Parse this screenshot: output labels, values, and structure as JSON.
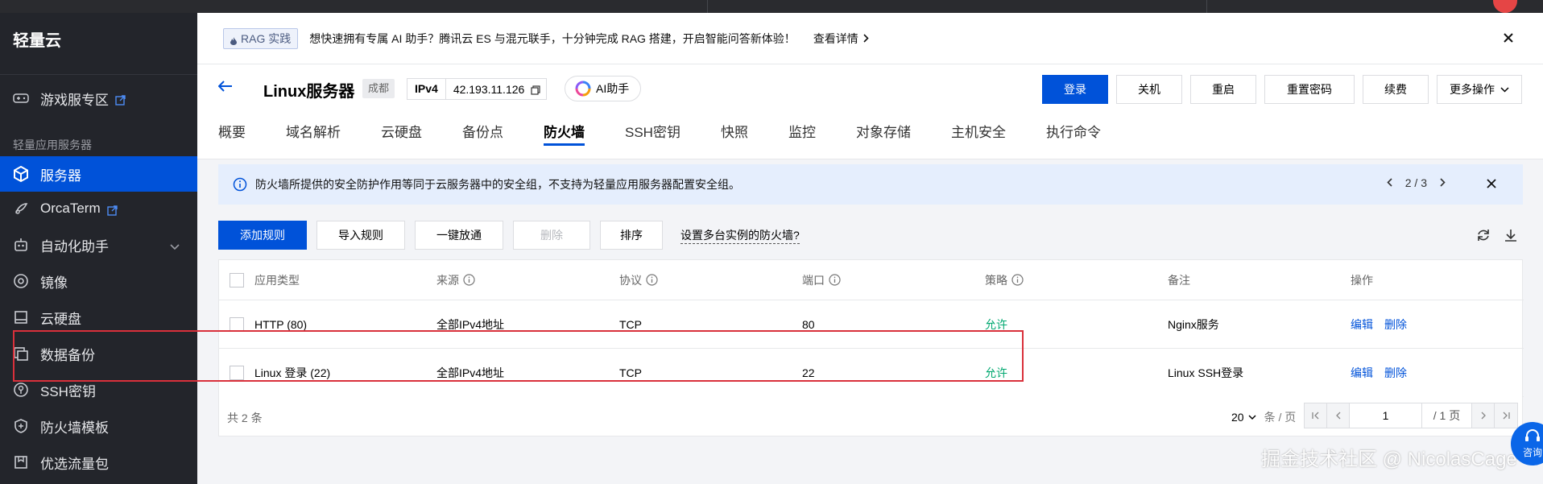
{
  "sidebar": {
    "brand": "轻量云",
    "items": [
      {
        "label": "游戏服专区",
        "icon": "gamepad-icon"
      },
      {
        "label": "服务器",
        "icon": "cube-icon"
      },
      {
        "label": "OrcaTerm",
        "icon": "terminal-icon"
      },
      {
        "label": "自动化助手",
        "icon": "robot-icon"
      },
      {
        "label": "镜像",
        "icon": "disc-icon"
      },
      {
        "label": "云硬盘",
        "icon": "disk-icon"
      },
      {
        "label": "数据备份",
        "icon": "backup-icon"
      },
      {
        "label": "SSH密钥",
        "icon": "key-icon"
      },
      {
        "label": "防火墙模板",
        "icon": "shield-icon"
      },
      {
        "label": "优选流量包",
        "icon": "package-icon"
      }
    ],
    "section_label": "轻量应用服务器"
  },
  "banner": {
    "tag": "RAG 实践",
    "text": "想快速拥有专属 AI 助手？腾讯云 ES 与混元联手，十分钟完成 RAG 搭建，开启智能问答新体验！",
    "link": "查看详情"
  },
  "header": {
    "title": "Linux服务器",
    "region": "成都",
    "ip_label": "IPv4",
    "ip_value": "42.193.11.126",
    "ai_button": "AI助手",
    "buttons": {
      "login": "登录",
      "shutdown": "关机",
      "restart": "重启",
      "reset_password": "重置密码",
      "renew": "续费",
      "more": "更多操作"
    },
    "tabs": [
      "概要",
      "域名解析",
      "云硬盘",
      "备份点",
      "防火墙",
      "SSH密钥",
      "快照",
      "监控",
      "对象存储",
      "主机安全",
      "执行命令"
    ],
    "active_tab": "防火墙"
  },
  "notice": {
    "text": "防火墙所提供的安全防护作用等同于云服务器中的安全组，不支持为轻量应用服务器配置安全组。",
    "page": "2 / 3"
  },
  "toolbar": {
    "add_rule": "添加规则",
    "import_rule": "导入规则",
    "open_all": "一键放通",
    "delete": "删除",
    "sort": "排序",
    "multi_instance_link": "设置多台实例的防火墙?"
  },
  "table": {
    "headers": {
      "app_type": "应用类型",
      "source": "来源",
      "protocol": "协议",
      "port": "端口",
      "policy": "策略",
      "remark": "备注",
      "action": "操作"
    },
    "rows": [
      {
        "app_type": "HTTP (80)",
        "source": "全部IPv4地址",
        "protocol": "TCP",
        "port": "80",
        "policy": "允许",
        "remark": "Nginx服务",
        "edit": "编辑",
        "delete": "删除"
      },
      {
        "app_type": "Linux 登录 (22)",
        "source": "全部IPv4地址",
        "protocol": "TCP",
        "port": "22",
        "policy": "允许",
        "remark": "Linux SSH登录",
        "edit": "编辑",
        "delete": "删除"
      }
    ]
  },
  "footer": {
    "total": "共 2 条",
    "page_size": "20",
    "page_size_unit": "条 / 页",
    "current_page": "1",
    "total_pages": "/ 1 页"
  },
  "watermark": "掘金技术社区 @ NicolasCage",
  "float_button": {
    "label": "咨询"
  },
  "colors": {
    "primary": "#0052d9",
    "allow": "#00a870",
    "sidebar_bg": "#23252b",
    "highlight": "#d9303b"
  }
}
